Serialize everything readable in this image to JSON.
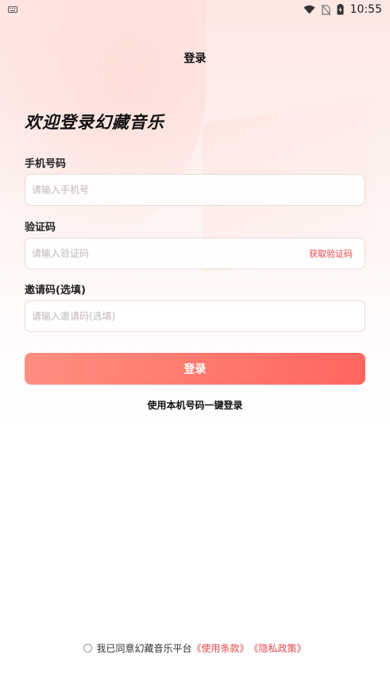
{
  "status_bar": {
    "time": "10:55",
    "icons": [
      "keyboard-icon",
      "wifi-icon",
      "no-sim-icon",
      "battery-charging-icon"
    ]
  },
  "header": {
    "title": "登录"
  },
  "welcome": {
    "text": "欢迎登录幻藏音乐"
  },
  "form": {
    "phone": {
      "label": "手机号码",
      "placeholder": "请输入手机号",
      "value": ""
    },
    "code": {
      "label": "验证码",
      "placeholder": "请输入验证码",
      "value": "",
      "get_code_label": "获取验证码"
    },
    "invite": {
      "label": "邀请码(选填)",
      "placeholder": "请输入邀请码(选填)",
      "value": ""
    }
  },
  "login_button": {
    "label": "登录"
  },
  "one_click_login": {
    "label": "使用本机号码一键登录"
  },
  "agreement": {
    "checked": false,
    "prefix": "我已同意幻藏音乐平台",
    "terms_link": "《使用条款》",
    "privacy_link": "《隐私政策》"
  },
  "colors": {
    "accent": "#e5484d",
    "button_start": "#ff8e80",
    "button_end": "#ff6660"
  }
}
